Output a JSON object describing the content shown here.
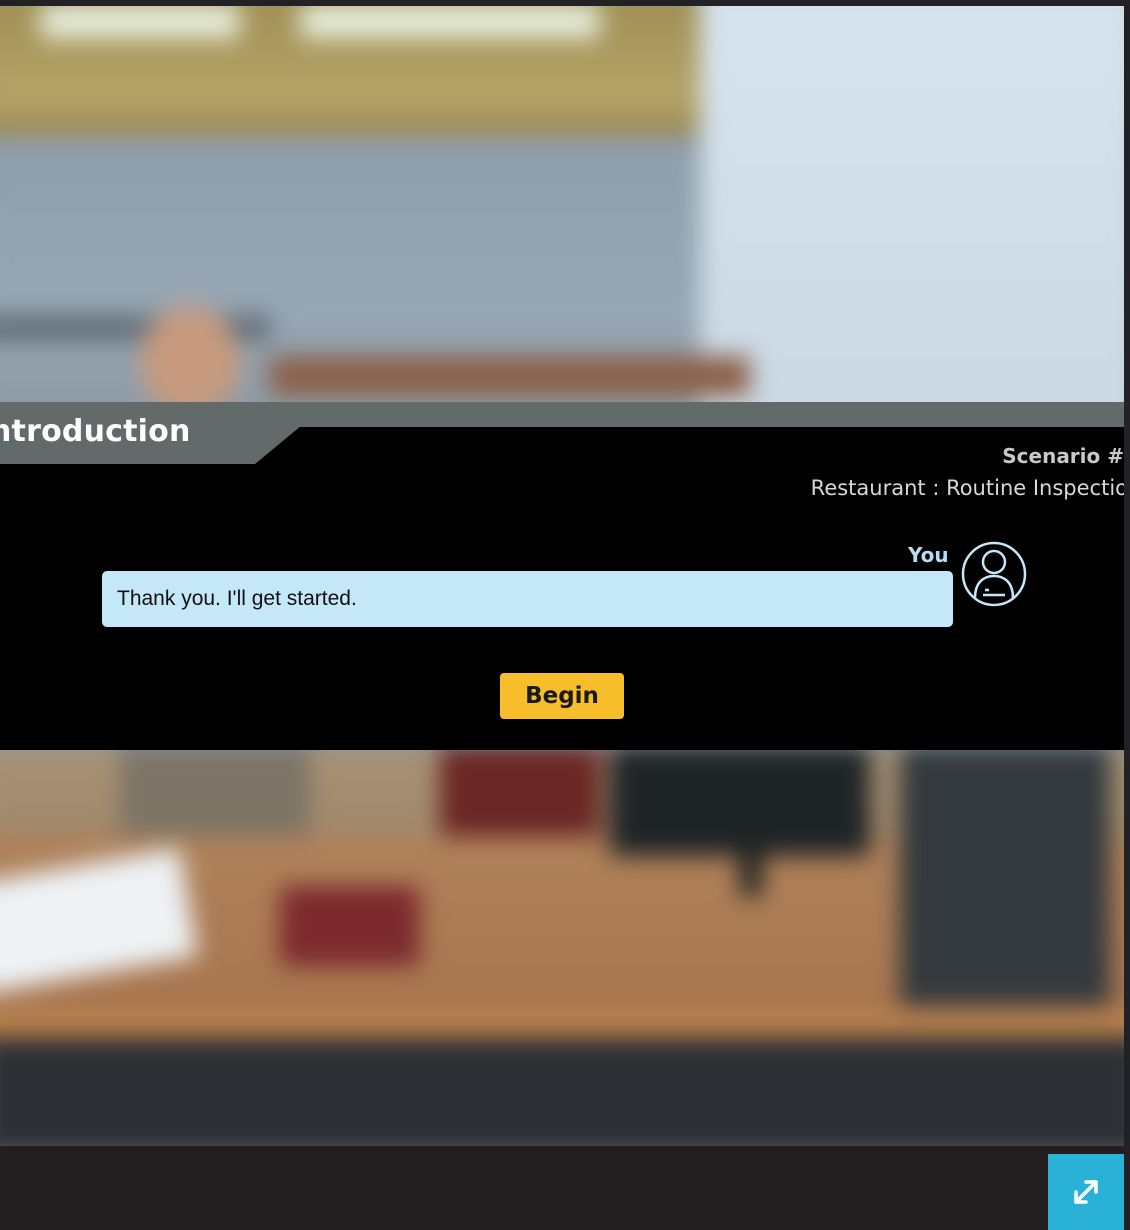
{
  "dialog": {
    "title": "ntroduction",
    "scenario_label": "Scenario #",
    "scenario_name": "Restaurant : Routine Inspectio",
    "speaker": "You",
    "message": "Thank you. I'll get started.",
    "begin_label": "Begin"
  },
  "icons": {
    "avatar": "user-avatar-icon",
    "fullscreen": "expand-fullscreen-icon"
  },
  "colors": {
    "dialog_bg": "#000000",
    "title_tab": "#626b6a",
    "bubble": "#c5e8f8",
    "speaker": "#b6dcf2",
    "begin_button": "#f7bd2b",
    "fullscreen_button": "#2ab1d8"
  }
}
